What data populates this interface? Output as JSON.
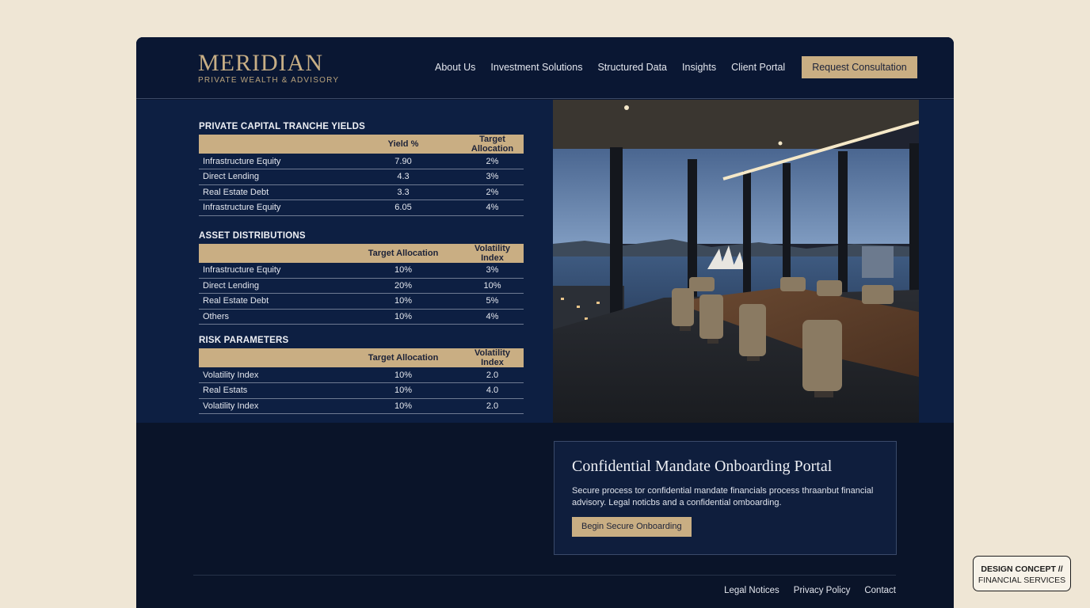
{
  "brand": {
    "name": "MERIDIAN",
    "tagline": "PRIVATE WEALTH & ADVISORY"
  },
  "nav": {
    "items": [
      "About Us",
      "Investment Solutions",
      "Structured Data",
      "Insights",
      "Client Portal"
    ],
    "cta": "Request Consultation"
  },
  "tables": [
    {
      "title": "PRIVATE CAPITAL TRANCHE YIELDS",
      "headers": [
        "",
        "Yield %",
        "Target Allocation"
      ],
      "rows": [
        [
          "Infrastructure Equity",
          "7.90",
          "2%"
        ],
        [
          "Direct Lending",
          "4.3",
          "3%"
        ],
        [
          "Real Estate Debt",
          "3.3",
          "2%"
        ],
        [
          "Infrastructure Equity",
          "6.05",
          "4%"
        ]
      ]
    },
    {
      "title": "ASSET DISTRIBUTIONS",
      "headers": [
        "",
        "Target Allocation",
        "Volatility Index"
      ],
      "rows": [
        [
          "Infrastructure Equity",
          "10%",
          "3%"
        ],
        [
          "Direct Lending",
          "20%",
          "10%"
        ],
        [
          "Real Estate Debt",
          "10%",
          "5%"
        ],
        [
          "Others",
          "10%",
          "4%"
        ]
      ]
    },
    {
      "title": "RISK PARAMETERS",
      "headers": [
        "",
        "Target Allocation",
        "Volatility Index"
      ],
      "rows": [
        [
          "Volatility Index",
          "10%",
          "2.0"
        ],
        [
          "Real Estats",
          "10%",
          "4.0"
        ],
        [
          "Volatility Index",
          "10%",
          "2.0"
        ]
      ]
    }
  ],
  "card": {
    "title": "Confidential Mandate Onboarding Portal",
    "text": "Secure process tor confidential mandate financials process thraanbut financial advisory. Legal noticbs and a confidential omboarding.",
    "button": "Begin Secure Onboarding"
  },
  "footer": {
    "links": [
      "Legal Notices",
      "Privacy Policy",
      "Contact"
    ]
  },
  "badge": {
    "line1": "DESIGN CONCEPT //",
    "line2": "FINANCIAL SERVICES"
  },
  "colors": {
    "navy": "#0b1630",
    "gold": "#c9ae83",
    "background": "#efe6d5"
  }
}
